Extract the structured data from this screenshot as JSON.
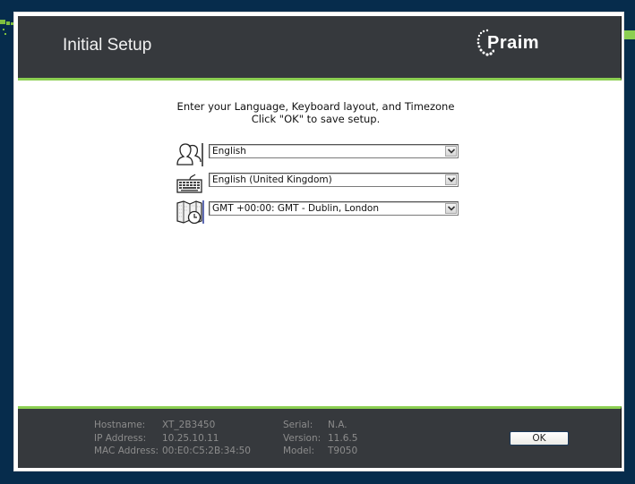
{
  "header": {
    "title": "Initial Setup",
    "logo_text": "Praim"
  },
  "instructions": {
    "line1": "Enter your Language, Keyboard layout, and Timezone",
    "line2": "Click \"OK\" to save setup."
  },
  "fields": [
    {
      "name": "language",
      "icon": "user-language-icon",
      "value": "English"
    },
    {
      "name": "keyboard",
      "icon": "keyboard-icon",
      "value": "English (United Kingdom)"
    },
    {
      "name": "timezone",
      "icon": "timezone-map-clock-icon",
      "value": "GMT +00:00: GMT - Dublin, London"
    }
  ],
  "footer": {
    "info_left": [
      {
        "label": "Hostname:",
        "value": "XT_2B3450"
      },
      {
        "label": "IP Address:",
        "value": "10.25.10.11"
      },
      {
        "label": "MAC Address:",
        "value": "00:E0:C5:2B:34:50"
      }
    ],
    "info_right": [
      {
        "label": "Serial:",
        "value": "N.A."
      },
      {
        "label": "Version:",
        "value": "11.6.5"
      },
      {
        "label": "Model:",
        "value": "T9050"
      }
    ],
    "ok_label": "OK"
  },
  "colors": {
    "background": "#062c4c",
    "panel": "#36393d",
    "accent": "#8ccf52"
  }
}
